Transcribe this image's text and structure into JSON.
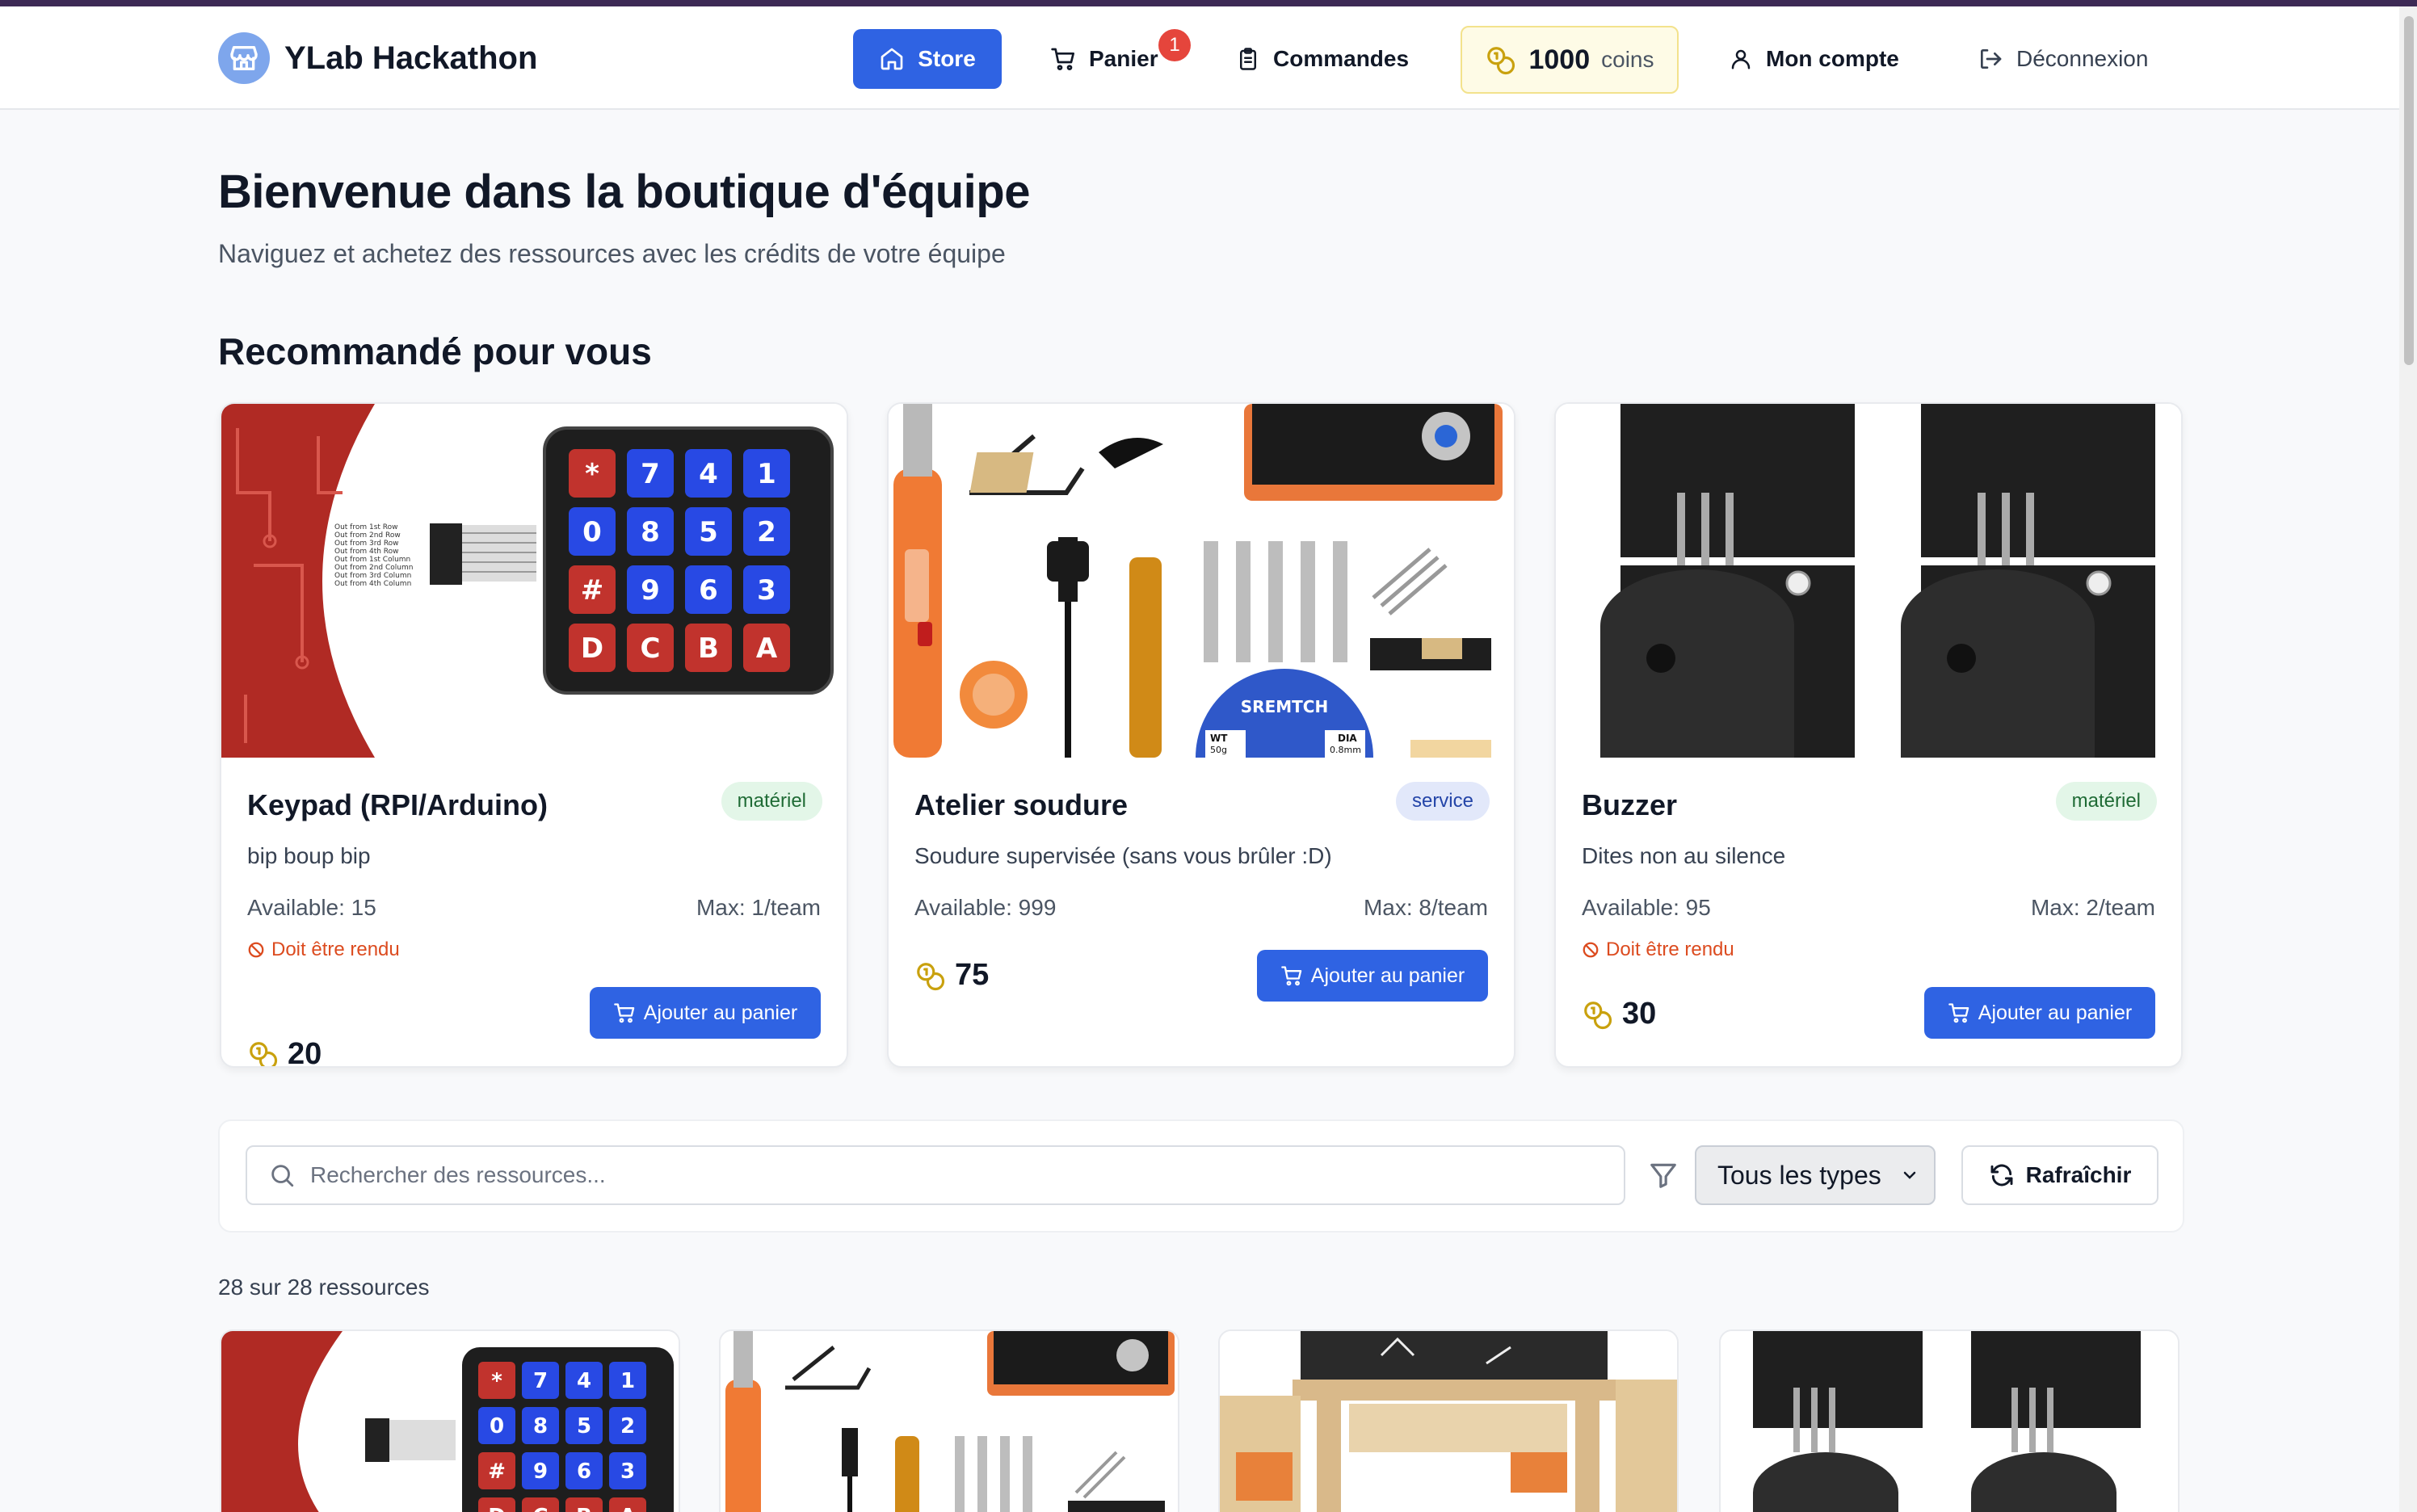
{
  "brand": {
    "name": "YLab Hackathon"
  },
  "nav": {
    "store": "Store",
    "cart": "Panier",
    "cart_count": "1",
    "orders": "Commandes",
    "coins_value": "1000",
    "coins_unit": "coins",
    "account": "Mon compte",
    "logout": "Déconnexion"
  },
  "hero": {
    "title": "Bienvenue dans la boutique d'équipe",
    "subtitle": "Naviguez et achetez des ressources avec les crédits de votre équipe"
  },
  "recommended": {
    "title": "Recommandé pour vous",
    "items": [
      {
        "name": "Keypad (RPI/Arduino)",
        "type": "matériel",
        "description": "bip boup bip",
        "available": "Available: 15",
        "max": "Max: 1/team",
        "return_note": "Doit être rendu",
        "price": "20",
        "button": "Ajouter au panier"
      },
      {
        "name": "Atelier soudure",
        "type": "service",
        "description": "Soudure supervisée (sans vous brûler :D)",
        "available": "Available: 999",
        "max": "Max: 8/team",
        "return_note": "",
        "price": "75",
        "button": "Ajouter au panier"
      },
      {
        "name": "Buzzer",
        "type": "matériel",
        "description": "Dites non au silence",
        "available": "Available: 95",
        "max": "Max: 2/team",
        "return_note": "Doit être rendu",
        "price": "30",
        "button": "Ajouter au panier"
      }
    ],
    "image_text": {
      "solder_brand": "SREMTCH",
      "solder_wt": "WT",
      "solder_weight": "50g",
      "solder_dia": "DIA",
      "solder_diameter": "0.8mm"
    }
  },
  "filters": {
    "search_placeholder": "Rechercher des ressources...",
    "type_selected": "Tous les types",
    "refresh": "Rafraîchir"
  },
  "results": {
    "count_text": "28 sur 28 ressources"
  },
  "colors": {
    "primary": "#2f63e3",
    "badge_red": "#e5453c",
    "coins_bg": "#fefbe6",
    "return_orange": "#dc4b1f"
  }
}
